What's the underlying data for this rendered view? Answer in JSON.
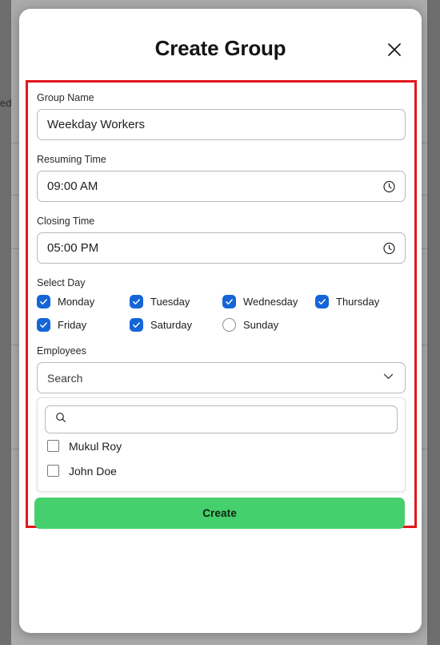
{
  "background": {
    "partial_text": "ed"
  },
  "modal": {
    "title": "Create Group",
    "close_icon": "close-icon",
    "form": {
      "group_name": {
        "label": "Group Name",
        "value": "Weekday Workers"
      },
      "resuming_time": {
        "label": "Resuming Time",
        "value": "09:00 AM",
        "icon": "clock-icon"
      },
      "closing_time": {
        "label": "Closing Time",
        "value": "05:00 PM",
        "icon": "clock-icon"
      },
      "select_day": {
        "label": "Select Day",
        "days": [
          {
            "label": "Monday",
            "checked": true
          },
          {
            "label": "Tuesday",
            "checked": true
          },
          {
            "label": "Wednesday",
            "checked": true
          },
          {
            "label": "Thursday",
            "checked": true
          },
          {
            "label": "Friday",
            "checked": true
          },
          {
            "label": "Saturday",
            "checked": true
          },
          {
            "label": "Sunday",
            "checked": false
          }
        ]
      },
      "employees": {
        "label": "Employees",
        "select_value": "Search",
        "chevron_icon": "chevron-down-icon",
        "search": {
          "value": "",
          "placeholder": "",
          "icon": "search-icon"
        },
        "options": [
          {
            "label": "Mukul Roy",
            "checked": false
          },
          {
            "label": "John Doe",
            "checked": false
          }
        ]
      }
    },
    "submit_label": "Create"
  },
  "colors": {
    "highlight_border": "#e2161d",
    "checkbox_checked": "#1565d8",
    "submit_background": "#45cf6d",
    "overlay": "#6e6e6e"
  }
}
